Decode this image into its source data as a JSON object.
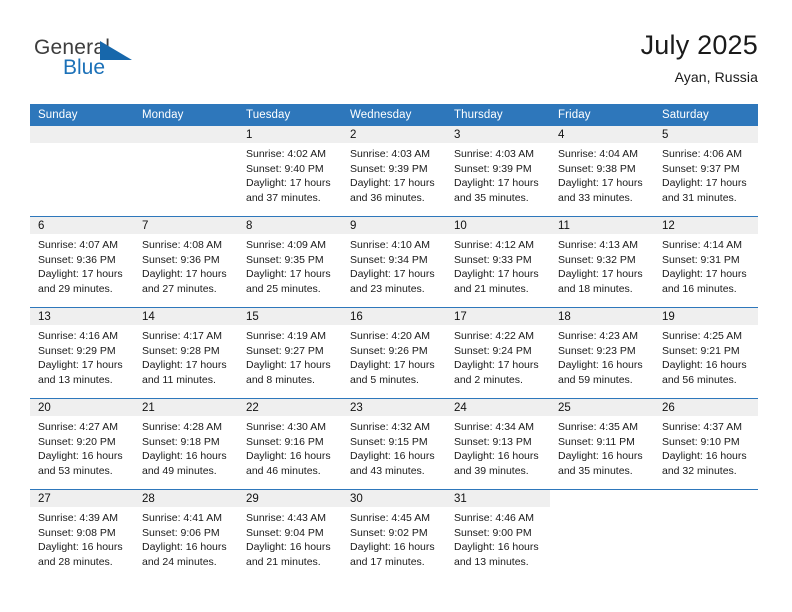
{
  "brand": {
    "name_top": "General",
    "name_bottom": "Blue",
    "accent_color": "#1767ab"
  },
  "header": {
    "title": "July 2025",
    "location": "Ayan, Russia"
  },
  "theme": {
    "header_row_bg": "#2e77bb",
    "daynum_band_bg": "#efefef",
    "separator": "#2e77bb"
  },
  "labels": {
    "sunrise_prefix": "Sunrise:",
    "sunset_prefix": "Sunset:",
    "daylight_prefix": "Daylight:"
  },
  "weekdays": [
    "Sunday",
    "Monday",
    "Tuesday",
    "Wednesday",
    "Thursday",
    "Friday",
    "Saturday"
  ],
  "weeks": [
    [
      {
        "day": "",
        "blank": true,
        "band": true
      },
      {
        "day": "",
        "blank": true,
        "band": true
      },
      {
        "day": "1",
        "sunrise": "Sunrise: 4:02 AM",
        "sunset": "Sunset: 9:40 PM",
        "daylight_1": "Daylight: 17 hours",
        "daylight_2": "and 37 minutes."
      },
      {
        "day": "2",
        "sunrise": "Sunrise: 4:03 AM",
        "sunset": "Sunset: 9:39 PM",
        "daylight_1": "Daylight: 17 hours",
        "daylight_2": "and 36 minutes."
      },
      {
        "day": "3",
        "sunrise": "Sunrise: 4:03 AM",
        "sunset": "Sunset: 9:39 PM",
        "daylight_1": "Daylight: 17 hours",
        "daylight_2": "and 35 minutes."
      },
      {
        "day": "4",
        "sunrise": "Sunrise: 4:04 AM",
        "sunset": "Sunset: 9:38 PM",
        "daylight_1": "Daylight: 17 hours",
        "daylight_2": "and 33 minutes."
      },
      {
        "day": "5",
        "sunrise": "Sunrise: 4:06 AM",
        "sunset": "Sunset: 9:37 PM",
        "daylight_1": "Daylight: 17 hours",
        "daylight_2": "and 31 minutes."
      }
    ],
    [
      {
        "day": "6",
        "sunrise": "Sunrise: 4:07 AM",
        "sunset": "Sunset: 9:36 PM",
        "daylight_1": "Daylight: 17 hours",
        "daylight_2": "and 29 minutes."
      },
      {
        "day": "7",
        "sunrise": "Sunrise: 4:08 AM",
        "sunset": "Sunset: 9:36 PM",
        "daylight_1": "Daylight: 17 hours",
        "daylight_2": "and 27 minutes."
      },
      {
        "day": "8",
        "sunrise": "Sunrise: 4:09 AM",
        "sunset": "Sunset: 9:35 PM",
        "daylight_1": "Daylight: 17 hours",
        "daylight_2": "and 25 minutes."
      },
      {
        "day": "9",
        "sunrise": "Sunrise: 4:10 AM",
        "sunset": "Sunset: 9:34 PM",
        "daylight_1": "Daylight: 17 hours",
        "daylight_2": "and 23 minutes."
      },
      {
        "day": "10",
        "sunrise": "Sunrise: 4:12 AM",
        "sunset": "Sunset: 9:33 PM",
        "daylight_1": "Daylight: 17 hours",
        "daylight_2": "and 21 minutes."
      },
      {
        "day": "11",
        "sunrise": "Sunrise: 4:13 AM",
        "sunset": "Sunset: 9:32 PM",
        "daylight_1": "Daylight: 17 hours",
        "daylight_2": "and 18 minutes."
      },
      {
        "day": "12",
        "sunrise": "Sunrise: 4:14 AM",
        "sunset": "Sunset: 9:31 PM",
        "daylight_1": "Daylight: 17 hours",
        "daylight_2": "and 16 minutes."
      }
    ],
    [
      {
        "day": "13",
        "sunrise": "Sunrise: 4:16 AM",
        "sunset": "Sunset: 9:29 PM",
        "daylight_1": "Daylight: 17 hours",
        "daylight_2": "and 13 minutes."
      },
      {
        "day": "14",
        "sunrise": "Sunrise: 4:17 AM",
        "sunset": "Sunset: 9:28 PM",
        "daylight_1": "Daylight: 17 hours",
        "daylight_2": "and 11 minutes."
      },
      {
        "day": "15",
        "sunrise": "Sunrise: 4:19 AM",
        "sunset": "Sunset: 9:27 PM",
        "daylight_1": "Daylight: 17 hours",
        "daylight_2": "and 8 minutes."
      },
      {
        "day": "16",
        "sunrise": "Sunrise: 4:20 AM",
        "sunset": "Sunset: 9:26 PM",
        "daylight_1": "Daylight: 17 hours",
        "daylight_2": "and 5 minutes."
      },
      {
        "day": "17",
        "sunrise": "Sunrise: 4:22 AM",
        "sunset": "Sunset: 9:24 PM",
        "daylight_1": "Daylight: 17 hours",
        "daylight_2": "and 2 minutes."
      },
      {
        "day": "18",
        "sunrise": "Sunrise: 4:23 AM",
        "sunset": "Sunset: 9:23 PM",
        "daylight_1": "Daylight: 16 hours",
        "daylight_2": "and 59 minutes."
      },
      {
        "day": "19",
        "sunrise": "Sunrise: 4:25 AM",
        "sunset": "Sunset: 9:21 PM",
        "daylight_1": "Daylight: 16 hours",
        "daylight_2": "and 56 minutes."
      }
    ],
    [
      {
        "day": "20",
        "sunrise": "Sunrise: 4:27 AM",
        "sunset": "Sunset: 9:20 PM",
        "daylight_1": "Daylight: 16 hours",
        "daylight_2": "and 53 minutes."
      },
      {
        "day": "21",
        "sunrise": "Sunrise: 4:28 AM",
        "sunset": "Sunset: 9:18 PM",
        "daylight_1": "Daylight: 16 hours",
        "daylight_2": "and 49 minutes."
      },
      {
        "day": "22",
        "sunrise": "Sunrise: 4:30 AM",
        "sunset": "Sunset: 9:16 PM",
        "daylight_1": "Daylight: 16 hours",
        "daylight_2": "and 46 minutes."
      },
      {
        "day": "23",
        "sunrise": "Sunrise: 4:32 AM",
        "sunset": "Sunset: 9:15 PM",
        "daylight_1": "Daylight: 16 hours",
        "daylight_2": "and 43 minutes."
      },
      {
        "day": "24",
        "sunrise": "Sunrise: 4:34 AM",
        "sunset": "Sunset: 9:13 PM",
        "daylight_1": "Daylight: 16 hours",
        "daylight_2": "and 39 minutes."
      },
      {
        "day": "25",
        "sunrise": "Sunrise: 4:35 AM",
        "sunset": "Sunset: 9:11 PM",
        "daylight_1": "Daylight: 16 hours",
        "daylight_2": "and 35 minutes."
      },
      {
        "day": "26",
        "sunrise": "Sunrise: 4:37 AM",
        "sunset": "Sunset: 9:10 PM",
        "daylight_1": "Daylight: 16 hours",
        "daylight_2": "and 32 minutes."
      }
    ],
    [
      {
        "day": "27",
        "sunrise": "Sunrise: 4:39 AM",
        "sunset": "Sunset: 9:08 PM",
        "daylight_1": "Daylight: 16 hours",
        "daylight_2": "and 28 minutes."
      },
      {
        "day": "28",
        "sunrise": "Sunrise: 4:41 AM",
        "sunset": "Sunset: 9:06 PM",
        "daylight_1": "Daylight: 16 hours",
        "daylight_2": "and 24 minutes."
      },
      {
        "day": "29",
        "sunrise": "Sunrise: 4:43 AM",
        "sunset": "Sunset: 9:04 PM",
        "daylight_1": "Daylight: 16 hours",
        "daylight_2": "and 21 minutes."
      },
      {
        "day": "30",
        "sunrise": "Sunrise: 4:45 AM",
        "sunset": "Sunset: 9:02 PM",
        "daylight_1": "Daylight: 16 hours",
        "daylight_2": "and 17 minutes."
      },
      {
        "day": "31",
        "sunrise": "Sunrise: 4:46 AM",
        "sunset": "Sunset: 9:00 PM",
        "daylight_1": "Daylight: 16 hours",
        "daylight_2": "and 13 minutes."
      },
      {
        "day": "",
        "blank": true,
        "band": false
      },
      {
        "day": "",
        "blank": true,
        "band": false
      }
    ]
  ]
}
